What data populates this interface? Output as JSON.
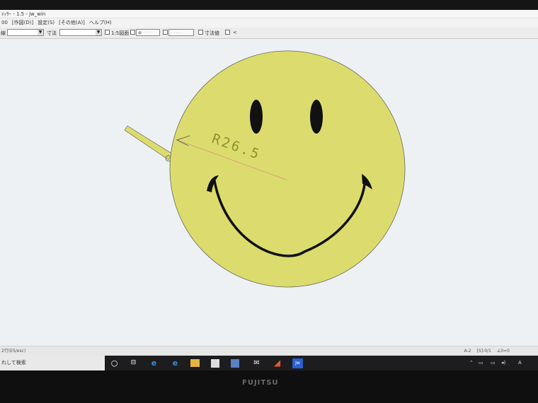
{
  "window": {
    "title": "ﾒｯｻｰ - 1.5 - jw_win"
  },
  "menu": {
    "items": [
      "00",
      "[作図(D)]",
      "設定(S)",
      "[その他(A)]",
      "ヘルプ(H)"
    ]
  },
  "toolbar": {
    "layer_label": "線",
    "dim_label": "寸法",
    "check_label_1": "1:5図面",
    "check_label_2": "寸法値",
    "check_label_3": "<"
  },
  "drawing": {
    "dimension_text": "R26.5",
    "face_color": "#dcdc6e",
    "line_color": "#111111",
    "dim_line_color": "#d9a07a"
  },
  "statusbar": {
    "left_text": "2行(ES/esc)",
    "right_items": [
      "A-2",
      "[S]-0/1",
      "∠0=0"
    ]
  },
  "taskbar": {
    "ime_text": "れして検索",
    "icons": [
      "start-circle-icon",
      "task-view-icon",
      "edge-icon",
      "ie-icon",
      "explorer-icon",
      "store-icon",
      "media-icon",
      "mail-icon",
      "jw-cad-icon",
      "jww-icon"
    ],
    "tray_text": "A"
  },
  "brand": {
    "text": "FUJITSU"
  }
}
